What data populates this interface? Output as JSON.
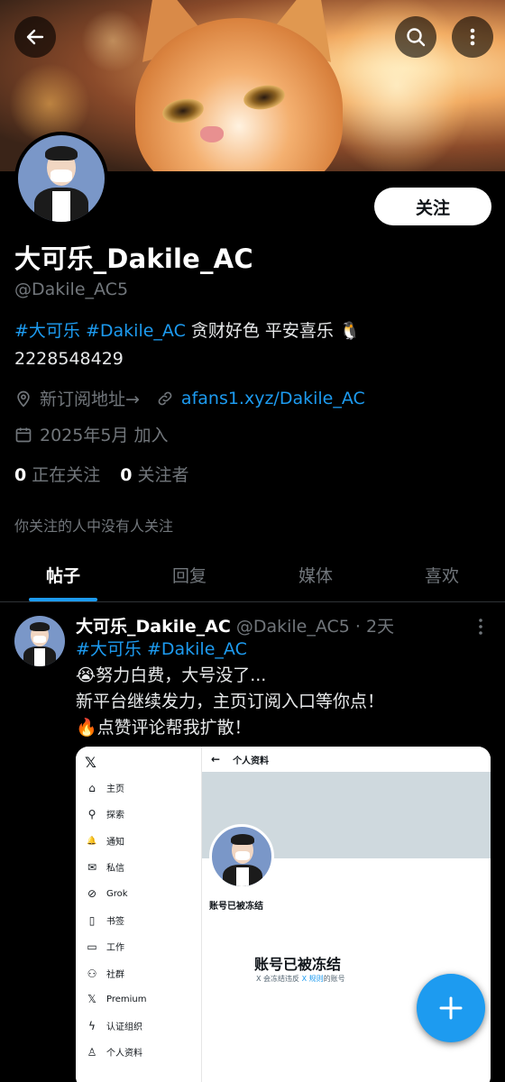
{
  "colors": {
    "background": "#000000",
    "accent": "#1d9bf0",
    "muted_text": "#71767b",
    "primary_text": "#e7e9ea"
  },
  "top_bar": {
    "back_icon": "arrow-left-icon",
    "search_icon": "search-icon",
    "more_icon": "more-vertical-icon"
  },
  "profile": {
    "follow_label": "关注",
    "display_name": "大可乐_Dakile_AC",
    "handle": "@Dakile_AC5",
    "bio": {
      "hashtag1": "#大可乐",
      "hashtag2": "#Dakile_AC",
      "text": " 贪财好色 平安喜乐 🐧",
      "number": "2228548429"
    },
    "location": "新订阅地址→",
    "website": "afans1.xyz/Dakile_AC",
    "joined": "2025年5月 加入",
    "following_count": "0",
    "following_label": "正在关注",
    "followers_count": "0",
    "followers_label": "关注者",
    "no_followers_known": "你关注的人中没有人关注"
  },
  "tabs": [
    {
      "label": "帖子",
      "active": true
    },
    {
      "label": "回复",
      "active": false
    },
    {
      "label": "媒体",
      "active": false
    },
    {
      "label": "喜欢",
      "active": false
    }
  ],
  "post": {
    "name": "大可乐_Dakile_AC",
    "handle": "@Dakile_AC5",
    "time": " · 2天",
    "hashtags": "#大可乐 #Dakile_AC",
    "line1": "😭努力白费，大号没了...",
    "line2": "新平台继续发力，主页订阅入口等你点！",
    "line3": "🔥点赞评论帮我扩散！"
  },
  "embed": {
    "logo": "𝕏",
    "header": "个人资料",
    "nav": [
      {
        "icon": "home-icon",
        "glyph": "⌂",
        "label": "主页"
      },
      {
        "icon": "search-icon",
        "glyph": "⚲",
        "label": "探索"
      },
      {
        "icon": "bell-icon",
        "glyph": "🔔",
        "label": "通知"
      },
      {
        "icon": "mail-icon",
        "glyph": "✉",
        "label": "私信"
      },
      {
        "icon": "grok-icon",
        "glyph": "⊘",
        "label": "Grok"
      },
      {
        "icon": "bookmark-icon",
        "glyph": "▯",
        "label": "书签"
      },
      {
        "icon": "briefcase-icon",
        "glyph": "▭",
        "label": "工作"
      },
      {
        "icon": "community-icon",
        "glyph": "⚇",
        "label": "社群"
      },
      {
        "icon": "x-premium-icon",
        "glyph": "𝕏",
        "label": "Premium"
      },
      {
        "icon": "lightning-icon",
        "glyph": "ϟ",
        "label": "认证组织"
      },
      {
        "icon": "person-icon",
        "glyph": "♙",
        "label": "个人资料"
      }
    ],
    "frozen_small": "账号已被冻结",
    "frozen_big": "账号已被冻结",
    "frozen_note_a": "X 会冻结违反 ",
    "frozen_note_link": "X 规则",
    "frozen_note_b": "的账号"
  },
  "fab_icon": "plus-icon"
}
